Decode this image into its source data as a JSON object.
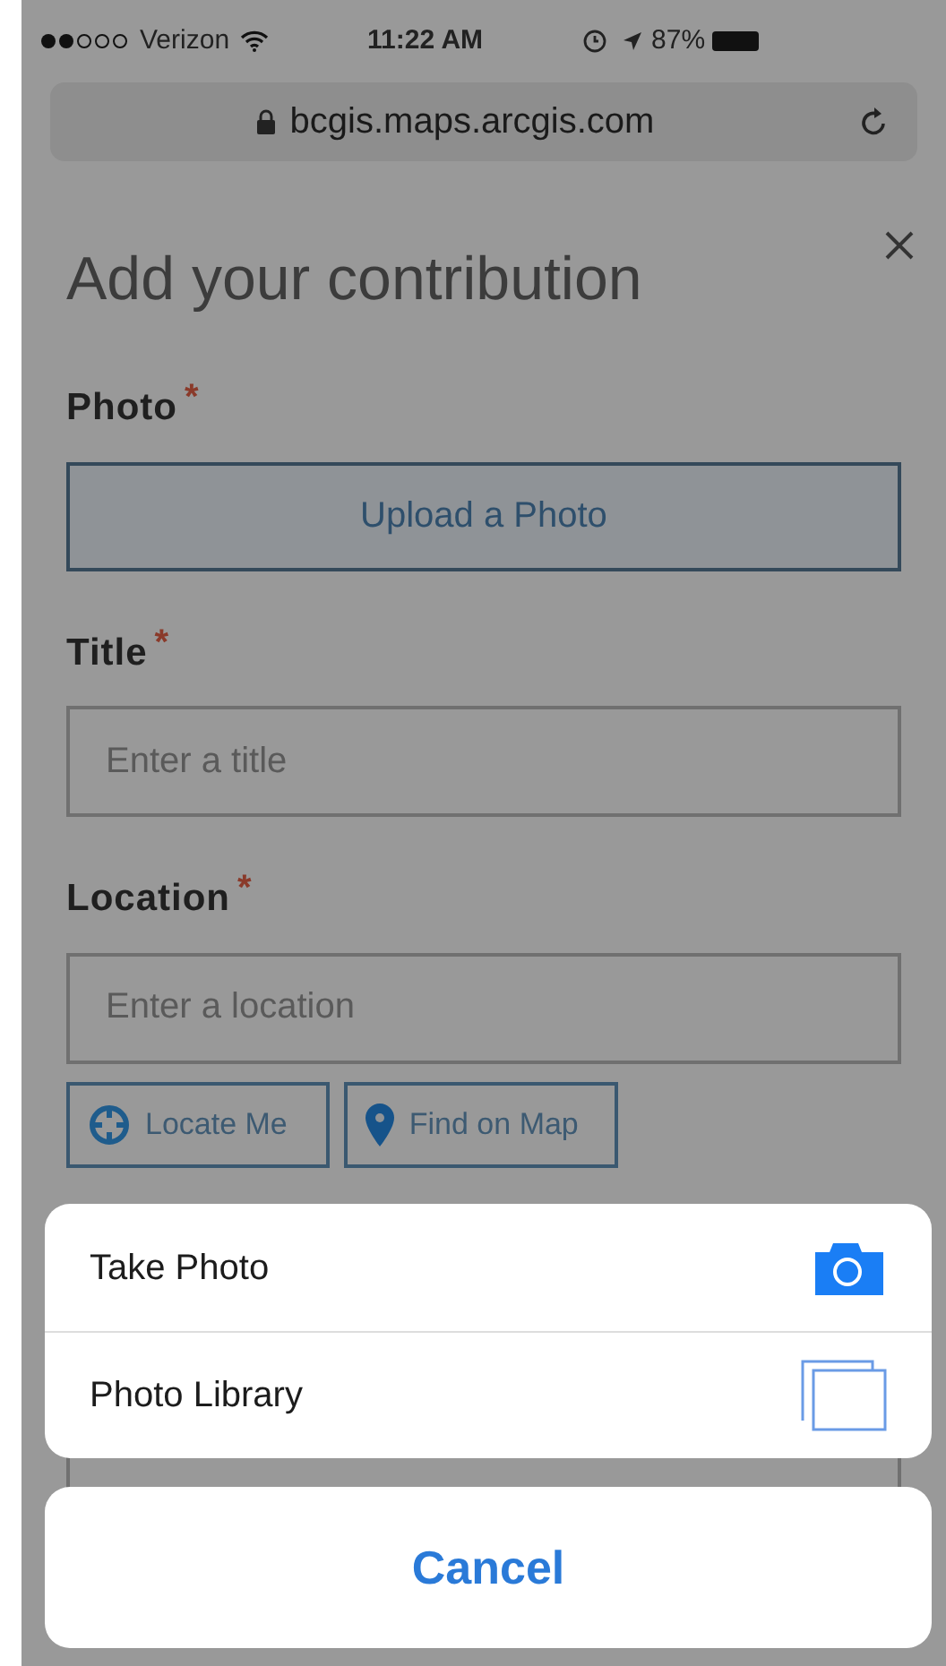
{
  "status_bar": {
    "carrier": "Verizon",
    "time": "11:22 AM",
    "battery": "87%"
  },
  "url_bar": {
    "url": "bcgis.maps.arcgis.com",
    "secure": true
  },
  "form": {
    "title": "Add your contribution",
    "fields": [
      {
        "kind": "upload",
        "label": "Photo",
        "required_mark": "*",
        "button": "Upload a Photo"
      },
      {
        "kind": "text",
        "label": "Title",
        "required_mark": "*",
        "placeholder": "Enter a title"
      },
      {
        "kind": "text",
        "label": "Location",
        "required_mark": "*",
        "placeholder": "Enter a location",
        "actions": [
          {
            "kind": "locate",
            "label": "Locate Me"
          },
          {
            "kind": "map",
            "label": "Find on Map"
          }
        ]
      }
    ]
  },
  "action_sheet": {
    "options": [
      {
        "kind": "camera",
        "label": "Take Photo"
      },
      {
        "kind": "library",
        "label": "Photo Library"
      }
    ],
    "cancel": "Cancel"
  }
}
